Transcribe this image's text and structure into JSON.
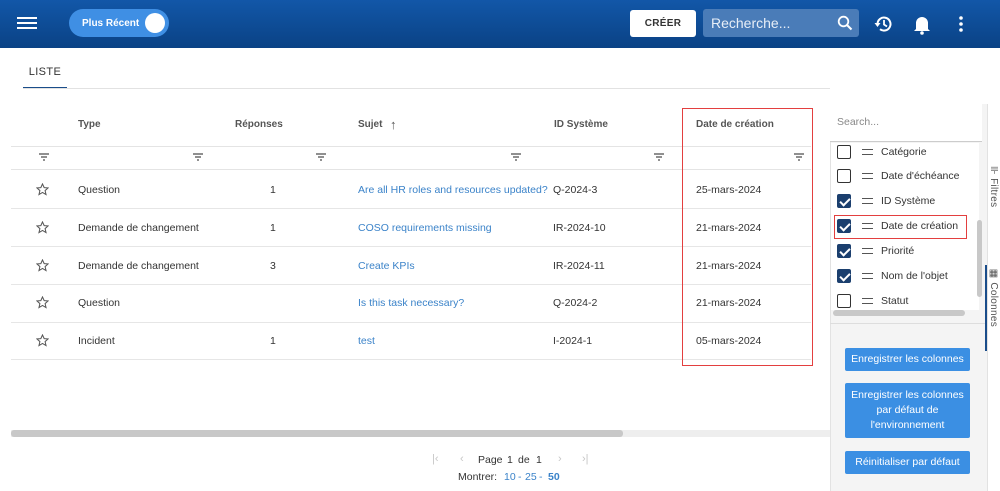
{
  "topbar": {
    "toggle_label": "Plus Récent",
    "create_label": "CRÉER",
    "search_placeholder": "Recherche..."
  },
  "tabs": [
    {
      "label": "LISTE",
      "active": true
    }
  ],
  "table": {
    "headers": [
      "Type",
      "Réponses",
      "Sujet",
      "ID Système",
      "Date de création"
    ],
    "sort_indicator": "↑",
    "rows": [
      {
        "type": "Question",
        "responses": "1",
        "subject": "Are all HR roles and resources updated?",
        "id": "Q-2024-3",
        "date": "25-mars-2024"
      },
      {
        "type": "Demande de changement",
        "responses": "1",
        "subject": "COSO requirements missing",
        "id": "IR-2024-10",
        "date": "21-mars-2024"
      },
      {
        "type": "Demande de changement",
        "responses": "3",
        "subject": "Create KPIs",
        "id": "IR-2024-11",
        "date": "21-mars-2024"
      },
      {
        "type": "Question",
        "responses": "",
        "subject": "Is this task necessary?",
        "id": "Q-2024-2",
        "date": "21-mars-2024"
      },
      {
        "type": "Incident",
        "responses": "1",
        "subject": "test",
        "id": "I-2024-1",
        "date": "05-mars-2024"
      }
    ]
  },
  "pagination": {
    "page_label": "Page",
    "page": "1",
    "of_label": "de",
    "total": "1",
    "show_label": "Montrer:",
    "options": [
      "10",
      "25",
      "50"
    ],
    "separator": "-",
    "selected": "50"
  },
  "panel": {
    "search_placeholder": "Search...",
    "columns": [
      {
        "label": "Catégorie",
        "checked": false
      },
      {
        "label": "Date d'échéance",
        "checked": false
      },
      {
        "label": "ID Système",
        "checked": true
      },
      {
        "label": "Date de création",
        "checked": true
      },
      {
        "label": "Priorité",
        "checked": true
      },
      {
        "label": "Nom de l'objet",
        "checked": true
      },
      {
        "label": "Statut",
        "checked": false
      }
    ],
    "buttons": {
      "save_columns": "Enregistrer les colonnes",
      "save_default": "Enregistrer les colonnes par défaut de l'environnement",
      "reset": "Réinitialiser par défaut"
    },
    "side_tabs": {
      "filters": "Filtres",
      "columns": "Colonnes"
    }
  },
  "colors": {
    "primary": "#0f4f9c",
    "accent": "#3b8fe3",
    "link": "#3b83c9",
    "highlight": "#e33f3f"
  }
}
